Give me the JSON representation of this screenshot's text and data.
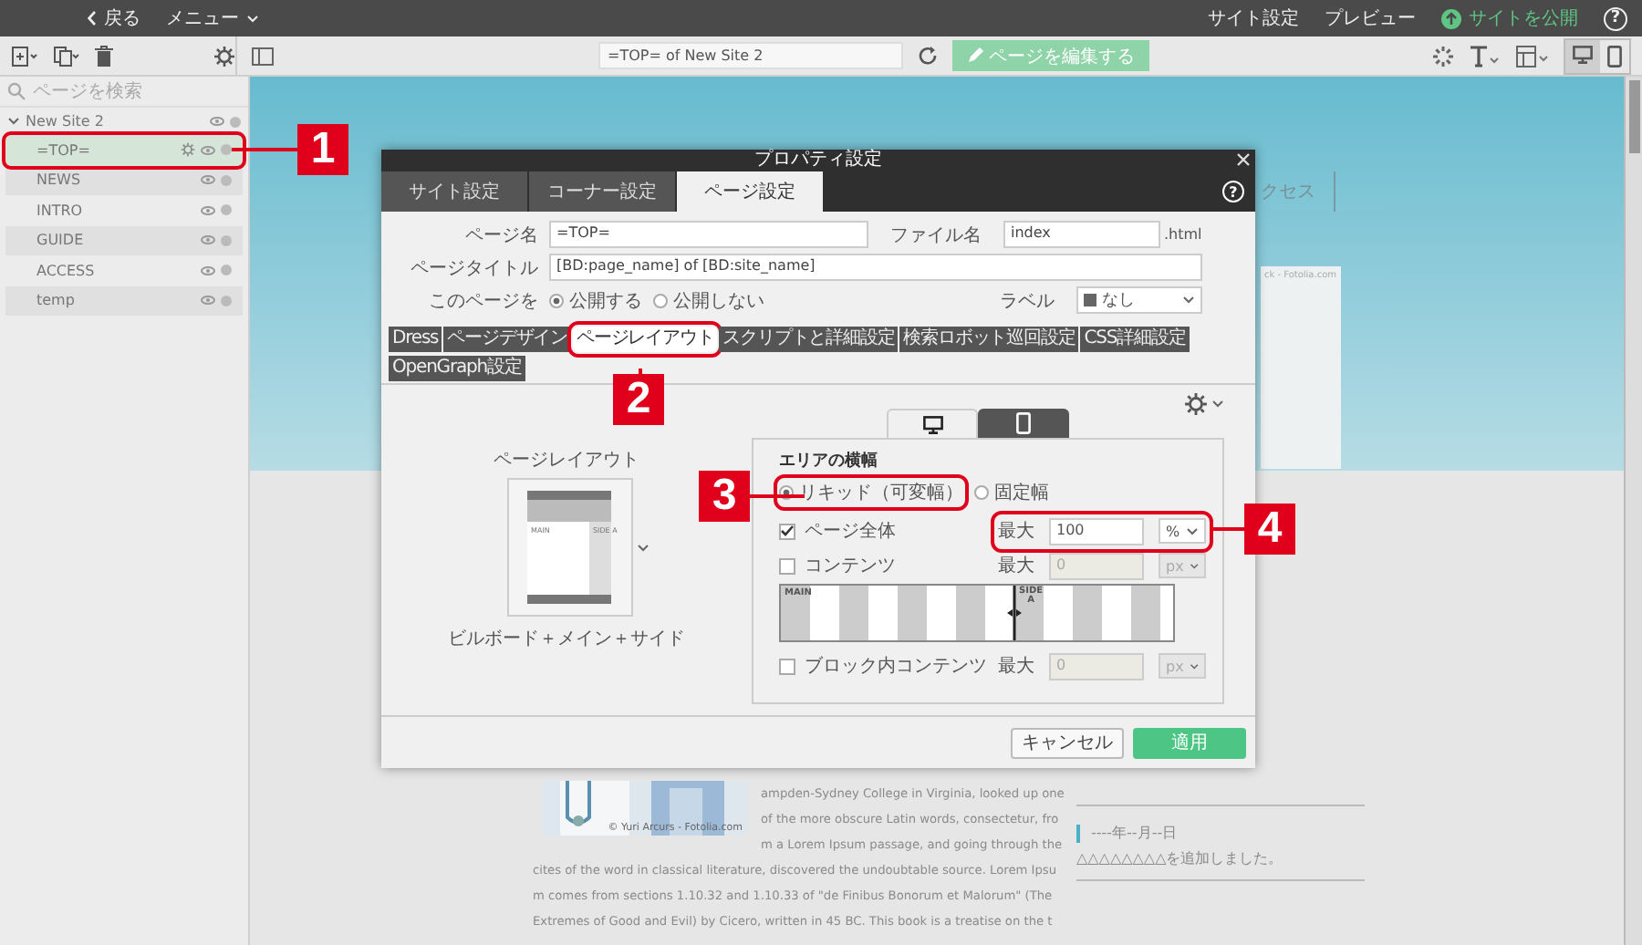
{
  "topbar": {
    "back": "戻る",
    "menu": "メニュー",
    "links": [
      "サイト設定",
      "プレビュー"
    ],
    "publish": "サイトを公開",
    "help": "?"
  },
  "toolbar": {
    "url": "=TOP= of New Site 2",
    "edit_button": "ページを編集する",
    "devices": [
      {
        "kind": "desktop",
        "selected": true
      },
      {
        "kind": "mobile",
        "selected": false
      }
    ]
  },
  "sidebar": {
    "search_placeholder": "ページを検索",
    "site": "New Site 2",
    "pages": [
      {
        "name": "=TOP=",
        "selected": true,
        "highlighted": true
      },
      {
        "name": "NEWS",
        "selected": false,
        "highlighted": false
      },
      {
        "name": "INTRO",
        "selected": false,
        "highlighted": false
      },
      {
        "name": "GUIDE",
        "selected": false,
        "highlighted": false
      },
      {
        "name": "ACCESS",
        "selected": false,
        "highlighted": false
      },
      {
        "name": "temp",
        "selected": false,
        "highlighted": false
      }
    ]
  },
  "preview": {
    "nav_text": "クセス",
    "photo_credit_top": "ck - Fotolia.com",
    "photo_credit": "© Yuri Arcurs - Fotolia.com",
    "side_lines": [
      "ampden-Sydney College in Virginia, looked up one",
      "of the more obscure Latin words, consectetur, fro",
      "m a Lorem Ipsum passage, and going through the"
    ],
    "body_lines": [
      "cites of the word in classical literature, discovered the undoubtable source. Lorem Ipsu",
      "m comes from sections 1.10.32 and 1.10.33 of \"de Finibus Bonorum et Malorum\" (The",
      "Extremes of Good and Evil) by Cicero, written in 45 BC. This book is a treatise on the t"
    ],
    "news": [
      {
        "date": "----年--月--日",
        "text": "△△△△△△△△を追加しました。"
      }
    ]
  },
  "dialog": {
    "title": "プロパティ設定",
    "help": "?",
    "tabs": [
      {
        "label": "サイト設定",
        "selected": false
      },
      {
        "label": "コーナー設定",
        "selected": false
      },
      {
        "label": "ページ設定",
        "selected": true
      }
    ],
    "page_name": {
      "label": "ページ名",
      "value": "=TOP="
    },
    "file_name": {
      "label": "ファイル名",
      "value": "index",
      "suffix": ".html"
    },
    "page_title": {
      "label": "ページタイトル",
      "value": "[BD:page_name] of [BD:site_name]"
    },
    "publish": {
      "label": "このページを",
      "options": [
        {
          "label": "公開する",
          "selected": true
        },
        {
          "label": "公開しない",
          "selected": false
        }
      ]
    },
    "label_field": {
      "label": "ラベル",
      "value": "なし"
    },
    "subtabs": [
      {
        "label": "Dress",
        "selected": false,
        "highlighted": false
      },
      {
        "label": "ページデザイン",
        "selected": false,
        "highlighted": false
      },
      {
        "label": "ページレイアウト",
        "selected": true,
        "highlighted": true
      },
      {
        "label": "スクリプトと詳細設定",
        "selected": false,
        "highlighted": false
      },
      {
        "label": "検索ロボット巡回設定",
        "selected": false,
        "highlighted": false
      },
      {
        "label": "CSS詳細設定",
        "selected": false,
        "highlighted": false
      },
      {
        "label": "OpenGraph設定",
        "selected": false,
        "highlighted": false
      }
    ],
    "layout": {
      "heading": "ページレイアウト",
      "name": "ビルボード＋メイン＋サイド",
      "thumb_main": "MAIN",
      "thumb_side": "SIDE A"
    },
    "area": {
      "heading": "エリアの横幅",
      "device_tabs": [
        {
          "kind": "desktop",
          "selected": true
        },
        {
          "kind": "mobile",
          "selected": false
        }
      ],
      "modes": [
        {
          "label": "リキッド（可変幅）",
          "selected": true,
          "highlighted": true
        },
        {
          "label": "固定幅",
          "selected": false,
          "highlighted": false
        }
      ],
      "rows": [
        {
          "label": "ページ全体",
          "checked": true,
          "max_label": "最大",
          "value": "100",
          "unit": "%",
          "highlighted": true
        },
        {
          "label": "コンテンツ",
          "checked": false,
          "max_label": "最大",
          "value": "0",
          "unit": "px",
          "highlighted": false
        },
        {
          "label": "ブロック内コンテンツ",
          "checked": false,
          "max_label": "最大",
          "value": "0",
          "unit": "px",
          "highlighted": false
        }
      ],
      "diagram": {
        "main": "MAIN",
        "side": "SIDE A"
      }
    },
    "buttons": {
      "cancel": "キャンセル",
      "apply": "適用"
    }
  },
  "callouts": [
    {
      "label": "1"
    },
    {
      "label": "2"
    },
    {
      "label": "3"
    },
    {
      "label": "4"
    }
  ]
}
